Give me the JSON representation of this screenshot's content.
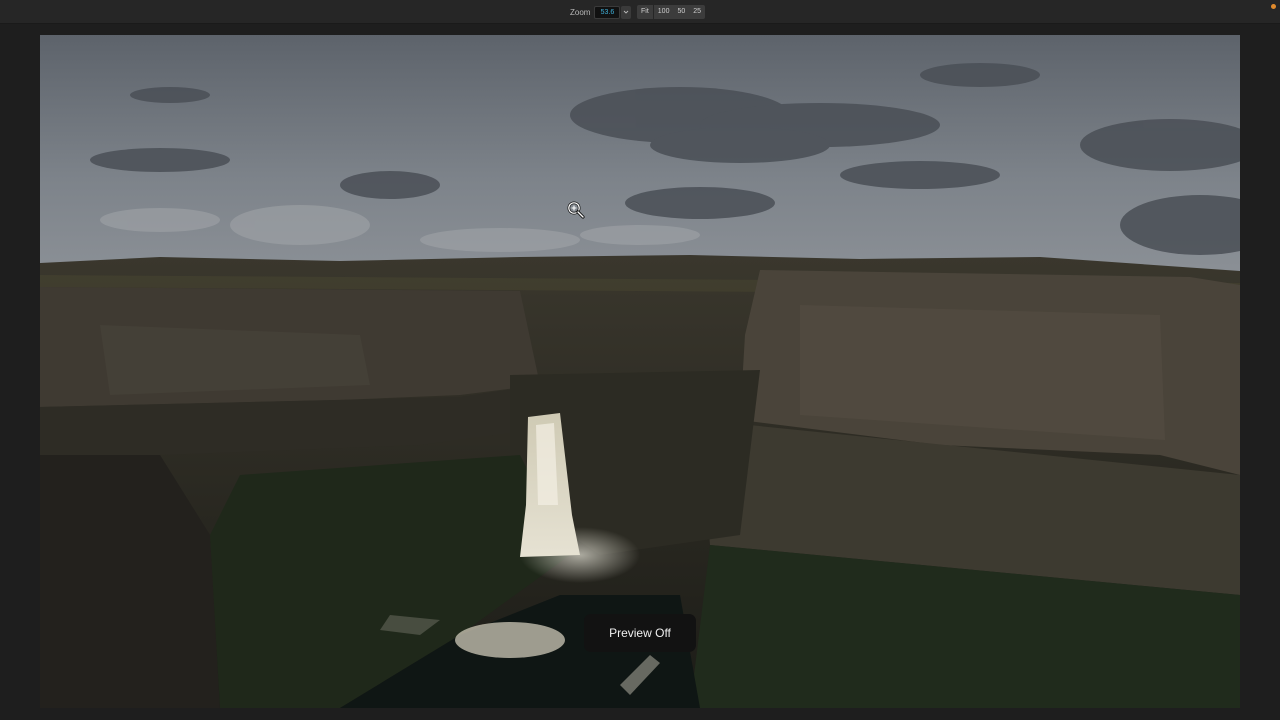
{
  "toolbar": {
    "zoom_label": "Zoom",
    "zoom_value": "53.6",
    "zoom_presets": [
      "Fit",
      "100",
      "50",
      "25"
    ],
    "accent_color": "#3fb0d9",
    "indicator_color": "#e08a2c"
  },
  "canvas": {
    "image_subject": "waterfall-canyon-photo"
  },
  "cursor": {
    "icon": "zoom-in-icon"
  },
  "toast": {
    "label": "Preview Off"
  }
}
